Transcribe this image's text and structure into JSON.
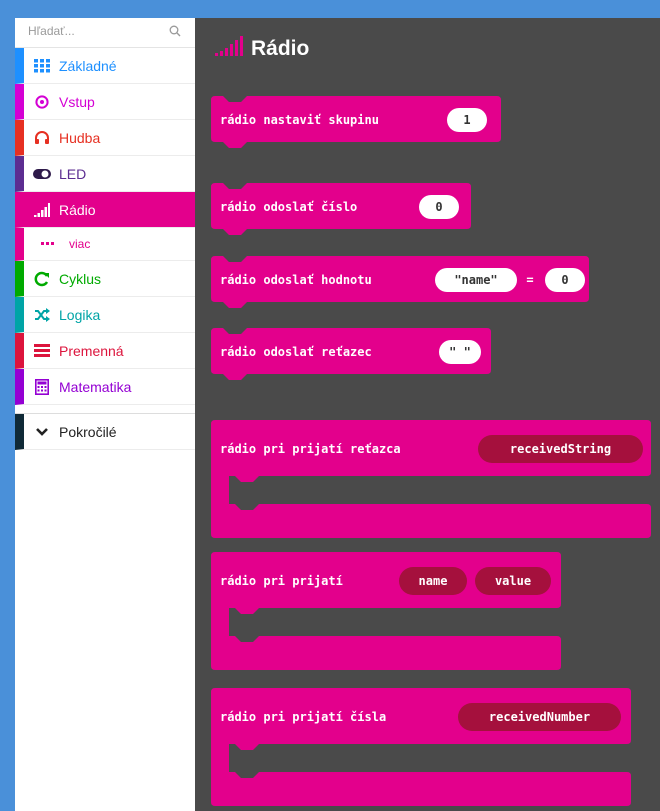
{
  "search": {
    "placeholder": "Hľadať..."
  },
  "categories": [
    {
      "label": "Základné",
      "icon": "grid-icon",
      "color": "#1e90ff"
    },
    {
      "label": "Vstup",
      "icon": "target-icon",
      "color": "#d400d4"
    },
    {
      "label": "Hudba",
      "icon": "headphones-icon",
      "color": "#e63022"
    },
    {
      "label": "LED",
      "icon": "toggle-icon",
      "color": "#5c2d91"
    },
    {
      "label": "Rádio",
      "icon": "signal-icon",
      "color": "#e3008c"
    },
    {
      "label": "viac",
      "icon": "more-icon",
      "color": "#e3008c"
    },
    {
      "label": "Cyklus",
      "icon": "loop-icon",
      "color": "#00aa00"
    },
    {
      "label": "Logika",
      "icon": "shuffle-icon",
      "color": "#00a4a6"
    },
    {
      "label": "Premenná",
      "icon": "list-icon",
      "color": "#dc143c"
    },
    {
      "label": "Matematika",
      "icon": "calculator-icon",
      "color": "#9400d3"
    },
    {
      "label": "Pokročilé",
      "icon": "chevron-down-icon",
      "color": "#102a37"
    }
  ],
  "workspace": {
    "title": "Rádio",
    "blocks": {
      "set_group": {
        "label": "rádio nastaviť skupinu",
        "value": "1"
      },
      "send_number": {
        "label": "rádio odoslať číslo",
        "value": "0"
      },
      "send_value": {
        "label": "rádio odoslať hodnotu",
        "name": "\"name\"",
        "eq": "=",
        "value": "0"
      },
      "send_string": {
        "label": "rádio odoslať reťazec",
        "value": "\" \""
      },
      "on_string": {
        "label": "rádio pri prijatí reťazca",
        "var": "receivedString"
      },
      "on_keyvalue": {
        "label": "rádio pri prijatí",
        "var1": "name",
        "var2": "value"
      },
      "on_number": {
        "label": "rádio pri prijatí čísla",
        "var": "receivedNumber"
      }
    }
  },
  "colors": {
    "block": "#e3008c",
    "block_dark": "#b8006f",
    "var_pill": "#a5103d",
    "workspace": "#4a4a4a",
    "frame": "#4a90d9"
  }
}
